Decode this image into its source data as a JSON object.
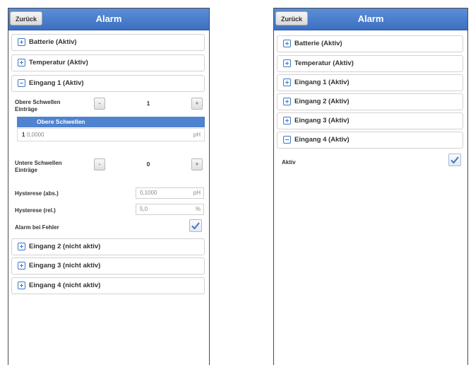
{
  "left": {
    "back_label": "Zurück",
    "title": "Alarm",
    "sections": {
      "batterie": "Batterie (Aktiv)",
      "temperatur": "Temperatur (Aktiv)",
      "eingang1": "Eingang 1 (Aktiv)",
      "eingang2": "Eingang 2 (nicht aktiv)",
      "eingang3": "Eingang 3 (nicht aktiv)",
      "eingang4": "Eingang 4 (nicht aktiv)"
    },
    "upper": {
      "label_line1": "Obere Schwellen",
      "label_line2": "Einträge",
      "minus": "-",
      "plus": "+",
      "value": "1",
      "table_header": "Obere Schwellen",
      "rows": [
        {
          "index": "1",
          "value": "0,0000",
          "unit": "pH"
        }
      ]
    },
    "lower": {
      "label_line1": "Untere Schwellen",
      "label_line2": "Einträge",
      "minus": "-",
      "plus": "+",
      "value": "0"
    },
    "hysterese_abs": {
      "label": "Hysterese (abs.)",
      "value": "0,1000",
      "unit": "pH"
    },
    "hysterese_rel": {
      "label": "Hysterese (rel.)",
      "value": "5,0",
      "unit": "%"
    },
    "alarm_bei_fehler": {
      "label": "Alarm bei Fehler",
      "checked": true
    }
  },
  "right": {
    "back_label": "Zurück",
    "title": "Alarm",
    "sections": {
      "batterie": "Batterie (Aktiv)",
      "temperatur": "Temperatur (Aktiv)",
      "eingang1": "Eingang 1 (Aktiv)",
      "eingang2": "Eingang 2 (Aktiv)",
      "eingang3": "Eingang 3 (Aktiv)",
      "eingang4": "Eingang 4 (Aktiv)"
    },
    "aktiv": {
      "label": "Aktiv",
      "checked": true
    }
  },
  "colors": {
    "header": "#3d6fc1",
    "accent": "#3b76c9",
    "table_header": "#4f82cf"
  }
}
